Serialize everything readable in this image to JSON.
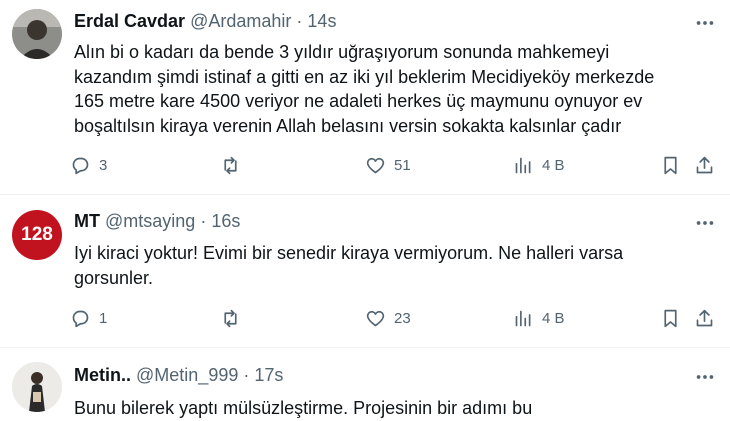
{
  "colors": {
    "text": "#0f1419",
    "muted": "#536471",
    "divider": "#eff3f4",
    "badge_red": "#c1121f"
  },
  "tweets": [
    {
      "name": "Erdal Cavdar",
      "handle": "@Ardamahir",
      "time": "14s",
      "text_lines": [
        "Alın bi o kadarı da bende 3 yıldır uğraşıyorum sonunda mahkemeyi",
        "kazandım şimdi istinaf a gitti en az iki yıl beklerim Mecidiyeköy merkezde",
        "165 metre kare 4500 veriyor ne adaleti herkes üç maymunu oynuyor ev",
        "boşaltılsın kiraya verenin Allah belasını versin sokakta kalsınlar çadır"
      ],
      "replies": "3",
      "reposts": "",
      "likes": "51",
      "views": "4 B"
    },
    {
      "name": "MT",
      "handle": "@mtsaying",
      "time": "16s",
      "avatar_text": "128",
      "text_lines": [
        "Iyi kiraci yoktur! Evimi bir senedir kiraya vermiyorum. Ne halleri varsa",
        "gorsunler."
      ],
      "replies": "1",
      "reposts": "",
      "likes": "23",
      "views": "4 B"
    },
    {
      "name": "Metin..",
      "handle": "@Metin_999",
      "time": "17s",
      "text_lines": [
        "Bunu bilerek yaptı mülsüzleştirme. Projesinin bir adımı bu"
      ]
    }
  ],
  "icons": {
    "reply": "reply-icon",
    "repost": "repost-icon",
    "like": "heart-icon",
    "views": "views-icon",
    "bookmark": "bookmark-icon",
    "share": "share-icon",
    "more": "more-icon"
  }
}
